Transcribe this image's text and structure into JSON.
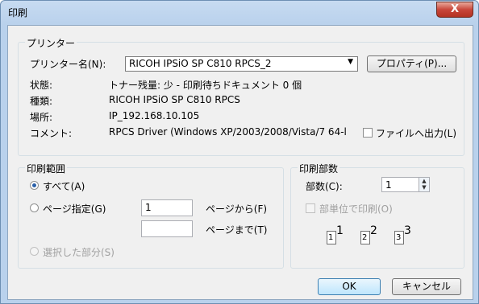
{
  "window": {
    "title": "印刷",
    "close_glyph": "X"
  },
  "printer_group": {
    "legend": "プリンター",
    "name_label": "プリンター名(N):",
    "name_value": "RICOH IPSiO SP C810 RPCS_2",
    "properties_button": "プロパティ(P)...",
    "status_label": "状態:",
    "status_value": "トナー残量: 少 - 印刷待ちドキュメント 0 個",
    "type_label": "種類:",
    "type_value": "RICOH IPSiO SP C810 RPCS",
    "where_label": "場所:",
    "where_value": "IP_192.168.10.105",
    "comment_label": "コメント:",
    "comment_value": "RPCS Driver (Windows XP/2003/2008/Vista/7 64-l",
    "print_to_file_label": "ファイルへ出力(L)"
  },
  "range_group": {
    "legend": "印刷範囲",
    "all_label": "すべて(A)",
    "pages_label": "ページ指定(G)",
    "from_value": "1",
    "from_suffix": "ページから(F)",
    "to_value": "",
    "to_suffix": "ページまで(T)",
    "selection_label": "選択した部分(S)"
  },
  "copies_group": {
    "legend": "印刷部数",
    "copies_label": "部数(C):",
    "copies_value": "1",
    "collate_label": "部単位で印刷(O)",
    "collate_pages": [
      "1",
      "1",
      "2",
      "2",
      "3",
      "3"
    ]
  },
  "footer": {
    "ok_label": "OK",
    "cancel_label": "キャンセル"
  }
}
